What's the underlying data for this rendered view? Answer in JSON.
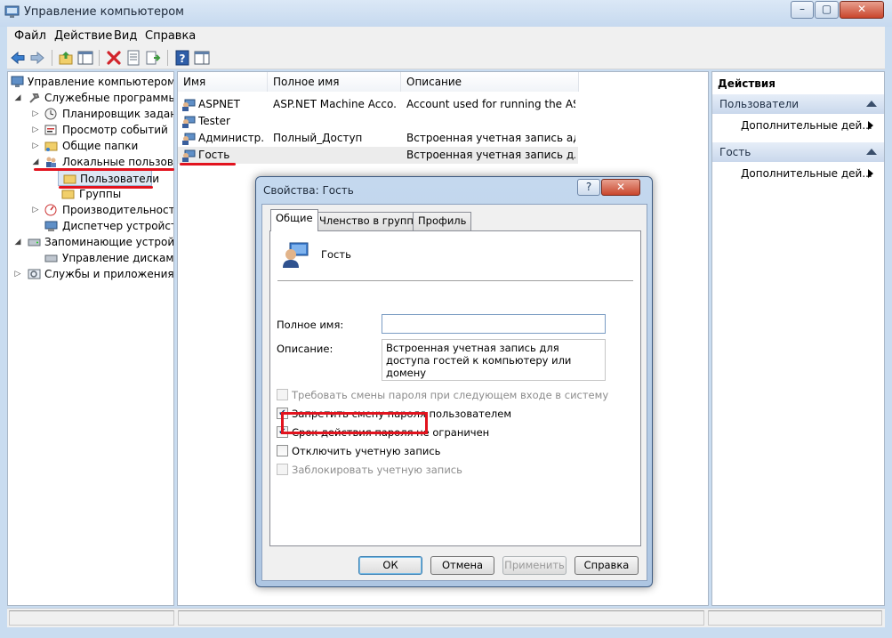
{
  "window": {
    "title": "Управление компьютером",
    "caption_buttons": {
      "minimize": "–",
      "maximize": "▢",
      "close": "✕"
    }
  },
  "menubar": [
    "Файл",
    "Действие",
    "Вид",
    "Справка"
  ],
  "toolbar": {
    "icons": [
      "back-icon",
      "forward-icon",
      "up-folder-icon",
      "show-hide-tree-icon",
      "delete-icon",
      "properties-icon",
      "export-icon",
      "help-icon",
      "show-action-pane-icon"
    ]
  },
  "tree": {
    "root": "Управление компьютером (л",
    "system_tools": "Служебные программы",
    "task_scheduler": "Планировщик заданий",
    "event_viewer": "Просмотр событий",
    "shared_folders": "Общие папки",
    "local_users": "Локальные пользовате",
    "users": "Пользователи",
    "groups": "Группы",
    "performance": "Производительность",
    "device_manager": "Диспетчер устройств",
    "storage": "Запоминающие устройст",
    "disk_management": "Управление дисками",
    "services_apps": "Службы и приложения"
  },
  "list": {
    "columns": [
      "Имя",
      "Полное имя",
      "Описание"
    ],
    "rows": [
      {
        "name": "ASPNET",
        "full_name": "ASP.NET Machine Acco...",
        "description": "Account used for running the AS..."
      },
      {
        "name": "Tester",
        "full_name": "",
        "description": ""
      },
      {
        "name": "Администр...",
        "full_name": "Полный_Доступ",
        "description": "Встроенная учетная запись адм..."
      },
      {
        "name": "Гость",
        "full_name": "",
        "description": "Встроенная учетная запись для ..."
      }
    ]
  },
  "actions": {
    "header": "Действия",
    "sections": [
      {
        "title": "Пользователи",
        "item": "Дополнительные дей..."
      },
      {
        "title": "Гость",
        "item": "Дополнительные дей..."
      }
    ]
  },
  "dialog": {
    "title": "Свойства: Гость",
    "help_glyph": "?",
    "close_glyph": "✕",
    "tabs": [
      "Общие",
      "Членство в группах",
      "Профиль"
    ],
    "user_name": "Гость",
    "full_name_label": "Полное имя:",
    "full_name_value": "",
    "description_label": "Описание:",
    "description_value": "Встроенная учетная запись для доступа гостей к компьютеру или домену",
    "checkboxes": [
      {
        "label": "Требовать смены пароля при следующем входе в систему",
        "checked": false,
        "disabled": true
      },
      {
        "label": "Запретить смену пароля пользователем",
        "checked": true,
        "disabled": false
      },
      {
        "label": "Срок действия пароля не ограничен",
        "checked": true,
        "disabled": false
      },
      {
        "label": "Отключить учетную запись",
        "checked": false,
        "disabled": false
      },
      {
        "label": "Заблокировать учетную запись",
        "checked": false,
        "disabled": true
      }
    ],
    "buttons": {
      "ok": "ОК",
      "cancel": "Отмена",
      "apply": "Применить",
      "help": "Справка"
    }
  },
  "colors": {
    "highlight": "#e2131e",
    "accent": "#3c7fb1"
  }
}
